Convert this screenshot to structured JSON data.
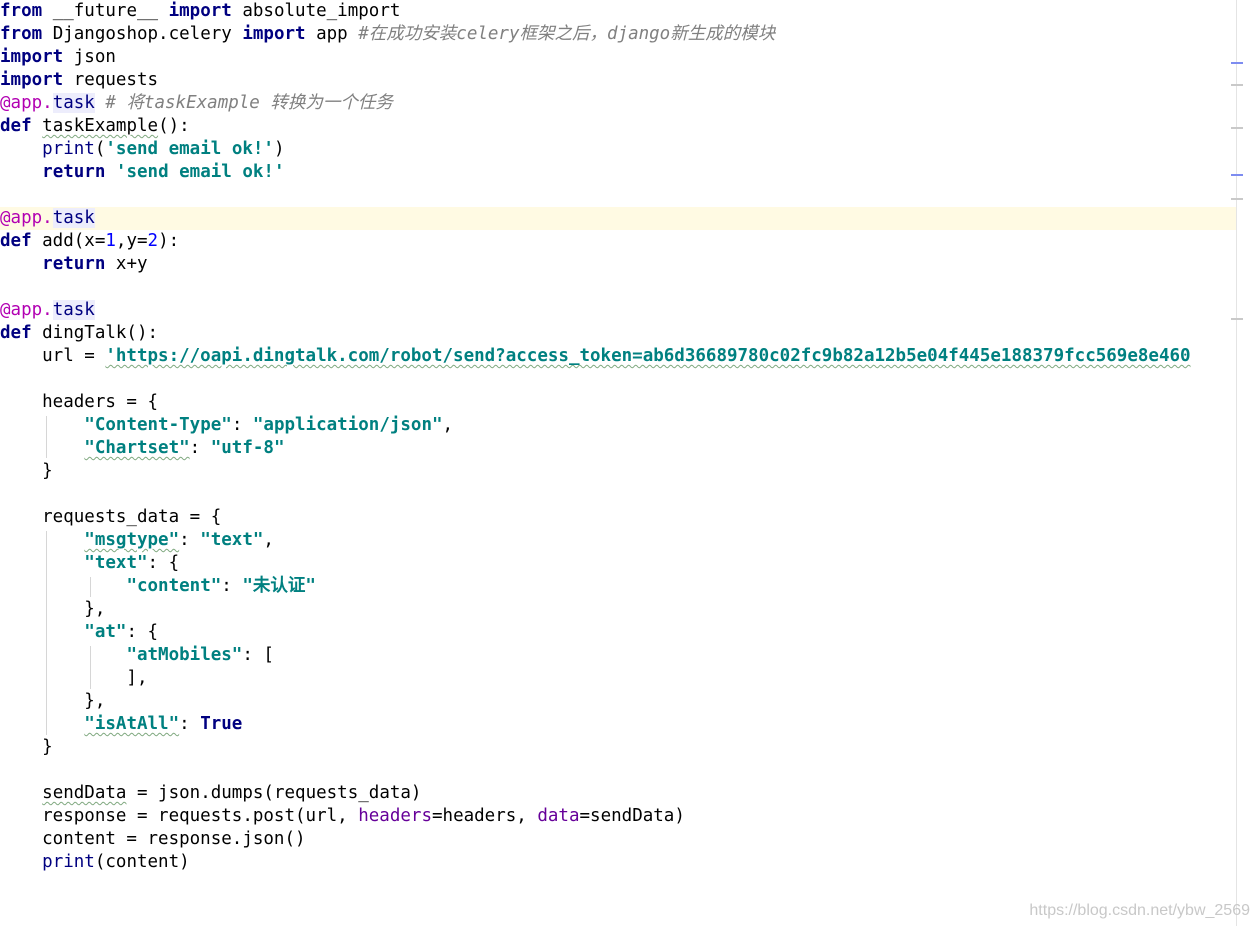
{
  "code": {
    "l1": {
      "kw1": "from",
      "a": " __future__ ",
      "kw2": "import",
      "b": " absolute_import"
    },
    "l2": {
      "kw1": "from",
      "a": " Djangoshop.celery ",
      "kw2": "import",
      "b": " app ",
      "comment": "#在成功安装celery框架之后，django新生成的模块"
    },
    "l3": {
      "kw": "import",
      "a": " json"
    },
    "l4": {
      "kw": "import",
      "a": " requests"
    },
    "l5": {
      "at": "@app.",
      "name": "task",
      "comment": " # 将taskExample 转换为一个任务"
    },
    "l6": {
      "kw": "def",
      "a": " ",
      "fname": "taskExample",
      "b": "():"
    },
    "l7": {
      "a": "    ",
      "fn": "print",
      "b": "(",
      "str": "'send email ok!'",
      "c": ")"
    },
    "l8": {
      "a": "    ",
      "kw": "return",
      "b": " ",
      "str": "'send email ok!'"
    },
    "l10": {
      "at": "@app.",
      "name": "task"
    },
    "l11": {
      "kw": "def",
      "a": " add(x=",
      "n1": "1",
      "b": ",y=",
      "n2": "2",
      "c": "):"
    },
    "l12": {
      "a": "    ",
      "kw": "return",
      "b": " x+y"
    },
    "l14": {
      "at": "@app.",
      "name": "task"
    },
    "l15": {
      "kw": "def",
      "a": " dingTalk():"
    },
    "l16": {
      "a": "    url = ",
      "str": "'https://oapi.dingtalk.com/robot/send?access_token=ab6d36689780c02fc9b82a12b5e04f445e188379fcc569e8e460"
    },
    "l18": {
      "a": "    headers = {"
    },
    "l19": {
      "a": "        ",
      "s1": "\"Content-Type\"",
      "b": ": ",
      "s2": "\"application/json\"",
      "c": ","
    },
    "l20": {
      "a": "        ",
      "s1": "\"Chartset\"",
      "b": ": ",
      "s2": "\"utf-8\""
    },
    "l21": {
      "a": "    }"
    },
    "l23": {
      "a": "    requests_data = {"
    },
    "l24": {
      "a": "        ",
      "s1": "\"msgtype\"",
      "b": ": ",
      "s2": "\"text\"",
      "c": ","
    },
    "l25": {
      "a": "        ",
      "s1": "\"text\"",
      "b": ": {"
    },
    "l26": {
      "a": "            ",
      "s1": "\"content\"",
      "b": ": ",
      "s2": "\"未认证\""
    },
    "l27": {
      "a": "        },"
    },
    "l28": {
      "a": "        ",
      "s1": "\"at\"",
      "b": ": {"
    },
    "l29": {
      "a": "            ",
      "s1": "\"atMobiles\"",
      "b": ": ["
    },
    "l30": {
      "a": "            ],"
    },
    "l31": {
      "a": "        },"
    },
    "l32": {
      "a": "        ",
      "s1": "\"isAtAll\"",
      "b": ": ",
      "kw": "True"
    },
    "l33": {
      "a": "    }"
    },
    "l35": {
      "a": "    ",
      "v": "sendData",
      "b": " = json.dumps(requests_data)"
    },
    "l36": {
      "a": "    response = requests.post(url, ",
      "k1": "headers",
      "b": "=headers, ",
      "k2": "data",
      "c": "=sendData)"
    },
    "l37": {
      "a": "    content = response.json()"
    },
    "l38": {
      "a": "    ",
      "fn": "print",
      "b": "(content)"
    }
  },
  "watermark": "https://blog.csdn.net/ybw_2569",
  "colors": {
    "keyword": "#000080",
    "string": "#008080",
    "number": "#0000ff",
    "comment": "#808080",
    "decorator": "#b200b2",
    "caret_line": "#fffae3"
  }
}
